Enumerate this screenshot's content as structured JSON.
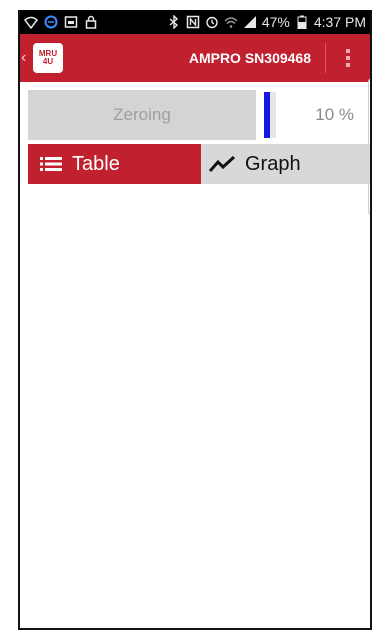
{
  "status_bar": {
    "battery_percent": "47%",
    "time": "4:37 PM",
    "left_icons": [
      "wifi-calling-icon",
      "sync-icon",
      "gallery-icon",
      "lock-icon"
    ],
    "right_icons": [
      "bluetooth-icon",
      "nfc-icon",
      "alarm-icon",
      "wifi-icon",
      "signal-icon",
      "battery-icon"
    ]
  },
  "app_bar": {
    "logo_top": "MRU",
    "logo_bottom": "4U",
    "title": "AMPRO SN309468",
    "background_color": "#c1202e"
  },
  "progress": {
    "button_label": "Zeroing",
    "percent_text": "10 %",
    "value": 10,
    "bar_color": "#1717e6"
  },
  "tabs": [
    {
      "label": "Table",
      "icon": "list-icon",
      "active": true
    },
    {
      "label": "Graph",
      "icon": "line-chart-icon",
      "active": false
    }
  ]
}
